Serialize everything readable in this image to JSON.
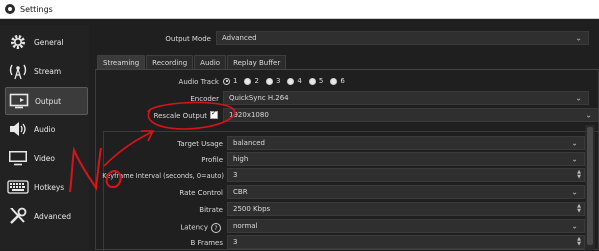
{
  "window": {
    "title": "Settings"
  },
  "sidebar": {
    "items": [
      {
        "label": "General",
        "icon": "gear-icon"
      },
      {
        "label": "Stream",
        "icon": "antenna-icon"
      },
      {
        "label": "Output",
        "icon": "monitor-icon"
      },
      {
        "label": "Audio",
        "icon": "speaker-icon"
      },
      {
        "label": "Video",
        "icon": "display-icon"
      },
      {
        "label": "Hotkeys",
        "icon": "keyboard-icon"
      },
      {
        "label": "Advanced",
        "icon": "tools-icon"
      }
    ],
    "active": "Output"
  },
  "output": {
    "mode_label": "Output Mode",
    "mode_value": "Advanced"
  },
  "tabs": [
    "Streaming",
    "Recording",
    "Audio",
    "Replay Buffer"
  ],
  "streaming": {
    "audio_track": {
      "label": "Audio Track",
      "options": [
        "1",
        "2",
        "3",
        "4",
        "5",
        "6"
      ],
      "selected": "1"
    },
    "encoder": {
      "label": "Encoder",
      "value": "QuickSync H.264"
    },
    "rescale": {
      "label": "Rescale Output",
      "checked": true,
      "value": "1920x1080"
    },
    "target_usage": {
      "label": "Target Usage",
      "value": "balanced"
    },
    "profile": {
      "label": "Profile",
      "value": "high"
    },
    "keyframe": {
      "label": "Keyframe Interval (seconds, 0=auto)",
      "value": "3"
    },
    "rate_control": {
      "label": "Rate Control",
      "value": "CBR"
    },
    "bitrate": {
      "label": "Bitrate",
      "value": "2500 Kbps"
    },
    "latency": {
      "label": "Latency",
      "value": "normal"
    },
    "bframes": {
      "label": "B Frames",
      "value": "3"
    }
  },
  "annotation": {
    "text": "No",
    "color": "#d8141a"
  }
}
